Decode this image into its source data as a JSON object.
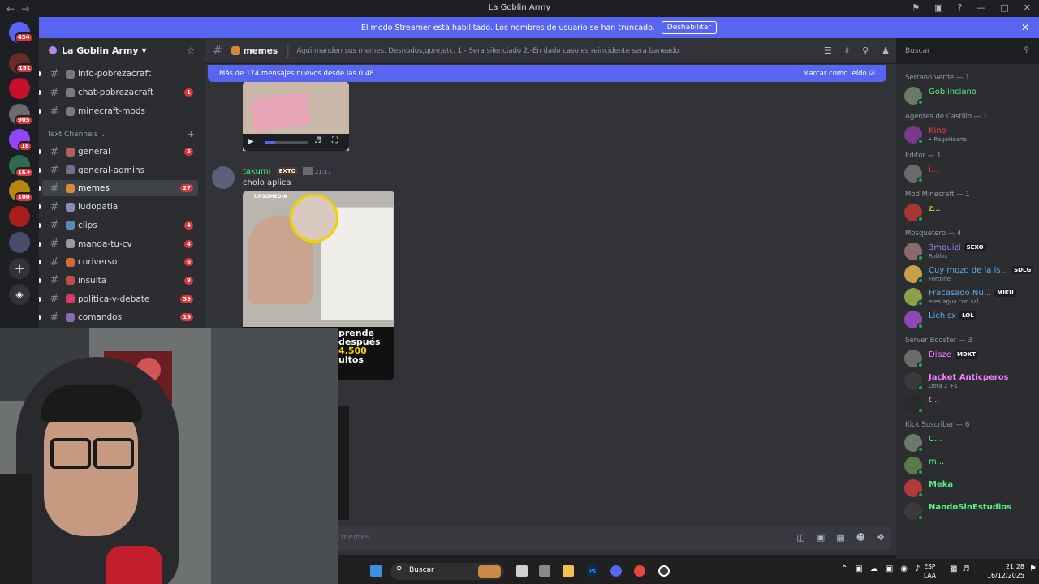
{
  "window": {
    "title": "La Goblin Army"
  },
  "banner": {
    "text": "El modo Streamer está habilitado. Los nombres de usuario se han truncado.",
    "button": "Deshabilitar"
  },
  "server_rail": {
    "badges": [
      "434",
      "151",
      "905",
      "18",
      "1K+",
      "100"
    ]
  },
  "guild": {
    "name": "La Goblin Army"
  },
  "channels_top": [
    {
      "name": "info-pobrezacraft",
      "badge": ""
    },
    {
      "name": "chat-pobrezacraft",
      "badge": "1"
    },
    {
      "name": "minecraft-mods",
      "badge": ""
    }
  ],
  "category": "Text Channels",
  "channels": [
    {
      "name": "general",
      "badge": "5",
      "color": "#b45f5f"
    },
    {
      "name": "general-admins",
      "badge": "",
      "color": "#7b6a8a"
    },
    {
      "name": "memes",
      "badge": "27",
      "color": "#d48a3a"
    },
    {
      "name": "ludopatia",
      "badge": "",
      "color": "#8a8ab4"
    },
    {
      "name": "clips",
      "badge": "4",
      "color": "#5a8ab4"
    },
    {
      "name": "manda-tu-cv",
      "badge": "4",
      "color": "#9a9a9a"
    },
    {
      "name": "coriverso",
      "badge": "6",
      "color": "#d46a3a"
    },
    {
      "name": "insulta",
      "badge": "9",
      "color": "#c44a4a"
    },
    {
      "name": "politica-y-debate",
      "badge": "39",
      "color": "#d43a6a"
    },
    {
      "name": "comandos",
      "badge": "19",
      "color": "#8a6ab4"
    }
  ],
  "chat": {
    "channel": "memes",
    "topic": "Aqui manden sus memes. Desnudos,gore,etc. 1.- Sera silenciado 2.-En dado caso es reincidente sera baneado",
    "new_messages": "Más de 174 mensajes nuevos desde las 0:48",
    "mark_read": "Marcar como leído",
    "search_placeholder": "Buscar",
    "composer_placeholder": "memes"
  },
  "message": {
    "author": "takumi",
    "tag": "EXTO",
    "time": "21:17",
    "text": "cholo aplica",
    "image_caption": [
      "prende",
      "después",
      "4.500",
      "ultos"
    ],
    "image_brand": "UPSOMEDIA"
  },
  "members": {
    "groups": [
      {
        "name": "Serrano verde — 1",
        "members": [
          {
            "name": "Goblinciano",
            "color": "#57f287",
            "sub": "",
            "tag": ""
          }
        ]
      },
      {
        "name": "Agentes de Castillo — 1",
        "members": [
          {
            "name": "Kino",
            "color": "#ed4245",
            "sub": "• RageHearts",
            "tag": ""
          }
        ]
      },
      {
        "name": "Editor — 1",
        "members": [
          {
            "name": "i...",
            "color": "#ed4245",
            "sub": "",
            "tag": ""
          }
        ]
      },
      {
        "name": "Mod Minecraft — 1",
        "members": [
          {
            "name": "z...",
            "color": "#fee75c",
            "sub": "",
            "tag": ""
          }
        ]
      },
      {
        "name": "Mosquetero — 4",
        "members": [
          {
            "name": "3mquizi",
            "color": "#9b84ee",
            "sub": "Roblox",
            "tag": "SEXO"
          },
          {
            "name": "Cuy mozo de la is...",
            "color": "#5dadec",
            "sub": "Fortnite",
            "tag": "SDLG"
          },
          {
            "name": "Fracasado Nu...",
            "color": "#5dadec",
            "sub": "eres agua con sal",
            "tag": "MIKU"
          },
          {
            "name": "Lichisx",
            "color": "#5dadec",
            "sub": "",
            "tag": "LOL"
          }
        ]
      },
      {
        "name": "Server Booster — 3",
        "members": [
          {
            "name": "Diaze",
            "color": "#f47fff",
            "sub": "",
            "tag": "MDKT"
          },
          {
            "name": "Jacket Anticperos",
            "color": "#f47fff",
            "sub": "Dota 2 +1",
            "tag": ""
          },
          {
            "name": "t...",
            "color": "#f47fff",
            "sub": "",
            "tag": ""
          }
        ]
      },
      {
        "name": "Kick Suscriber — 6",
        "members": [
          {
            "name": "C...",
            "color": "#57f287",
            "sub": "",
            "tag": ""
          },
          {
            "name": "m...",
            "color": "#57f287",
            "sub": "",
            "tag": ""
          },
          {
            "name": "Meka",
            "color": "#57f287",
            "sub": "",
            "tag": ""
          },
          {
            "name": "NandoSinEstudios",
            "color": "#57f287",
            "sub": "",
            "tag": ""
          }
        ]
      }
    ]
  },
  "taskbar": {
    "search": "Buscar",
    "lang1": "ESP",
    "lang2": "LAA",
    "time": "21:28",
    "date": "16/12/2025"
  }
}
